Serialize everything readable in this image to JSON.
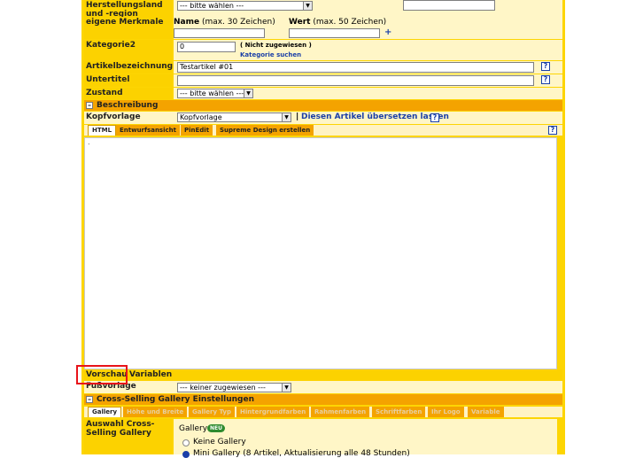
{
  "herkunft": {
    "label": "Herstellungsland und -region",
    "select": "--- bitte wählen ---"
  },
  "merkmale": {
    "label": "eigene Merkmale",
    "name_label": "Name",
    "name_hint": "(max. 30 Zeichen)",
    "wert_label": "Wert",
    "wert_hint": "(max. 50 Zeichen)",
    "add": "+"
  },
  "kategorie2": {
    "label": "Kategorie2",
    "value": "0",
    "status": "( Nicht zugewiesen )",
    "link": "Kategorie suchen"
  },
  "artikelbezeichnung": {
    "label": "Artikelbezeichnung",
    "value": "Testartikel #01"
  },
  "untertitel": {
    "label": "Untertitel",
    "value": ""
  },
  "zustand": {
    "label": "Zustand",
    "select": "--- bitte wählen ---"
  },
  "help_glyph": "?",
  "beschreibung": {
    "section_title": "Beschreibung",
    "kopfvorlage_label": "Kopfvorlage",
    "kopfvorlage_select": "Kopfvorlage",
    "separator": "|",
    "translate_link": "Diesen Artikel übersetzen lassen",
    "tabs": [
      "HTML",
      "Entwurfsansicht",
      "PinEdit",
      "Supreme Design erstellen"
    ],
    "editor_dot": "."
  },
  "bottom_tabs": {
    "vorschau": "Vorschau",
    "variablen": "Variablen"
  },
  "fussvorlage": {
    "label": "Fußvorlage",
    "select": "--- keiner zugewiesen ---"
  },
  "crossselling": {
    "section_title": "Cross-Selling Gallery Einstellungen",
    "tabs": [
      "Gallery",
      "Höhe und Breite",
      "Gallery Typ",
      "Hintergrundfarben",
      "Rahmenfarben",
      "Schriftfarben",
      "Ihr Logo",
      "Variable"
    ],
    "auswahl_label": "Auswahl Cross-Selling Gallery",
    "gallery_title": "Gallery",
    "badge": "NEU",
    "options": [
      "Keine Gallery",
      "Mini Gallery (8 Artikel, Aktualisierung alle 48 Stunden)"
    ]
  },
  "colors": {
    "frame": "#fdd503",
    "section": "#f4a300",
    "link": "#1a3fa8",
    "highlight": "#e8131a"
  }
}
